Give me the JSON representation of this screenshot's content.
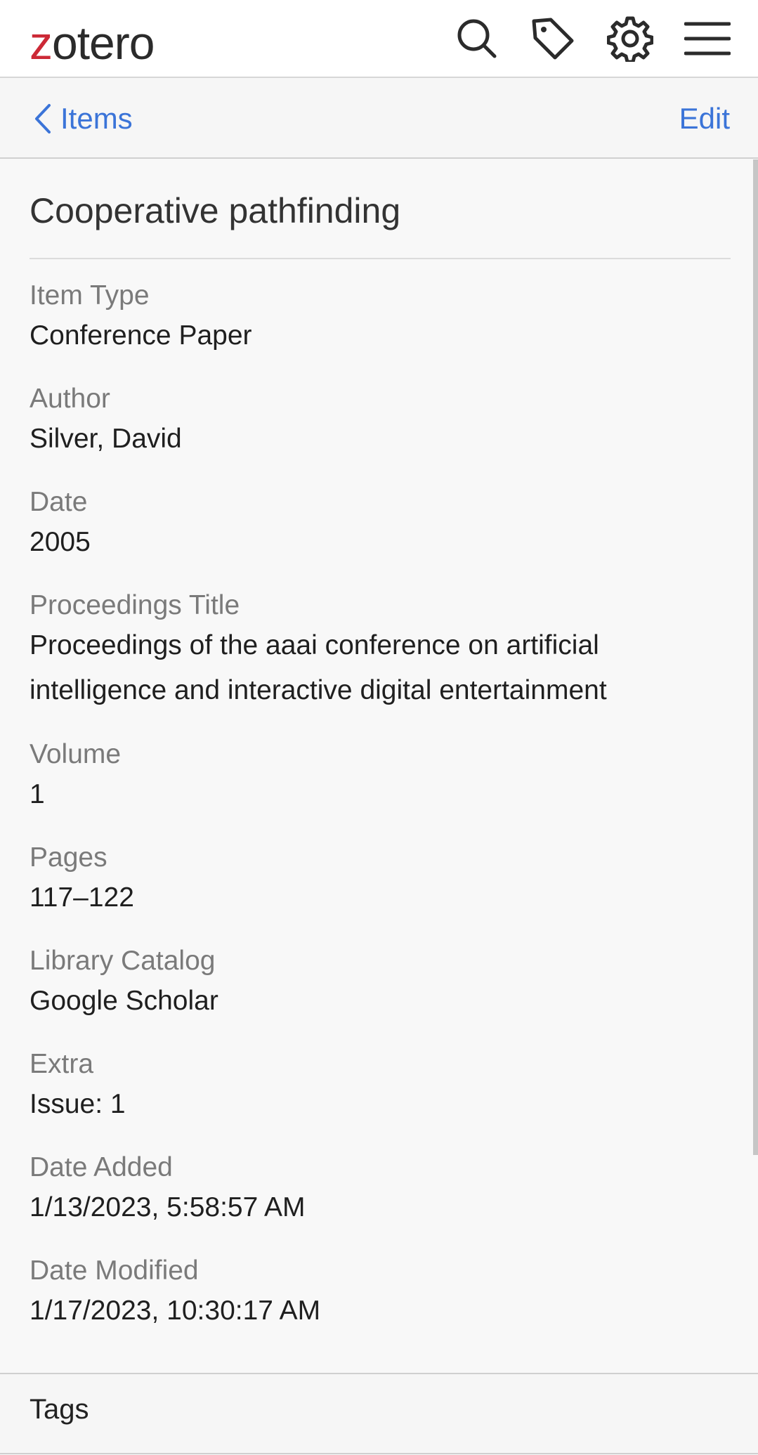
{
  "app": {
    "logo_first": "z",
    "logo_rest": "otero"
  },
  "header": {
    "icons": [
      "search-icon",
      "tag-icon",
      "gear-icon",
      "menu-icon"
    ]
  },
  "nav": {
    "back_label": "Items",
    "edit_label": "Edit"
  },
  "item": {
    "title": "Cooperative pathfinding",
    "fields": [
      {
        "label": "Item Type",
        "value": "Conference Paper"
      },
      {
        "label": "Author",
        "value": "Silver, David"
      },
      {
        "label": "Date",
        "value": "2005"
      },
      {
        "label": "Proceedings Title",
        "value_lines": [
          "Proceedings of the aaai conference on artificial",
          "intelligence and interactive digital entertainment"
        ]
      },
      {
        "label": "Volume",
        "value": "1"
      },
      {
        "label": "Pages",
        "value": "117–122"
      },
      {
        "label": "Library Catalog",
        "value": "Google Scholar"
      },
      {
        "label": "Extra",
        "value": "Issue: 1"
      },
      {
        "label": "Date Added",
        "value": "1/13/2023, 5:58:57 AM"
      },
      {
        "label": "Date Modified",
        "value": "1/17/2023, 10:30:17 AM"
      }
    ]
  },
  "tags_section": {
    "label": "Tags"
  },
  "colors": {
    "accent": "#3b74d8",
    "logo_z": "#cc2936"
  }
}
